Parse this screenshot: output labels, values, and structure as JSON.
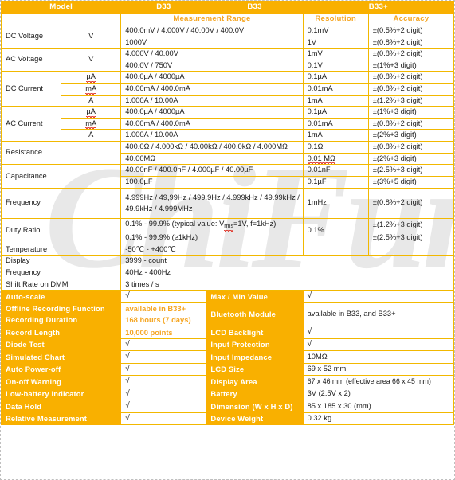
{
  "watermark": "ChiFun",
  "colors": {
    "accent": "#f9b000",
    "accent_text": "#f5a623",
    "border": "#f2b800"
  },
  "header": {
    "model": "Model",
    "d33": "D33",
    "b33": "B33",
    "b33plus": "B33+",
    "measurement_range": "Measurement Range",
    "resolution": "Resolution",
    "accuracy": "Accuracy"
  },
  "spec_rows": [
    {
      "name": "DC Voltage",
      "unit": "V",
      "range": "400.0mV / 4.000V / 40.00V / 400.0V",
      "resolution": "0.1mV",
      "accuracy": "±(0.5%+2 digit)"
    },
    {
      "name": "",
      "unit": "",
      "range": "1000V",
      "resolution": "1V",
      "accuracy": "±(0.8%+2 digit)"
    },
    {
      "name": "AC Voltage",
      "unit": "V",
      "range": "4.000V / 40.00V",
      "resolution": "1mV",
      "accuracy": "±(0.8%+2 digit)"
    },
    {
      "name": "",
      "unit": "",
      "range": "400.0V / 750V",
      "resolution": "0.1V",
      "accuracy": "±(1%+3 digit)"
    },
    {
      "name": "DC Current",
      "unit": "µA",
      "range": "400.0µA / 4000µA",
      "resolution": "0.1µA",
      "accuracy": "±(0.8%+2 digit)"
    },
    {
      "name": "",
      "unit": "mA",
      "range": "40.00mA / 400.0mA",
      "resolution": "0.01mA",
      "accuracy": "±(0.8%+2 digit)"
    },
    {
      "name": "",
      "unit": "A",
      "range": "1.000A / 10.00A",
      "resolution": "1mA",
      "accuracy": "±(1.2%+3 digit)"
    },
    {
      "name": "AC Current",
      "unit": "µA",
      "range": "400.0µA / 4000µA",
      "resolution": "0.1µA",
      "accuracy": "±(1%+3 digit)"
    },
    {
      "name": "",
      "unit": "mA",
      "range": "40.00mA / 400.0mA",
      "resolution": "0.01mA",
      "accuracy": "±(0.8%+2 digit)"
    },
    {
      "name": "",
      "unit": "A",
      "range": "1.000A / 10.00A",
      "resolution": "1mA",
      "accuracy": "±(2%+3 digit)"
    },
    {
      "name": "Resistance",
      "unit": "",
      "range": "400.0Ω / 4.000kΩ / 40.00kΩ / 400.0kΩ / 4.000MΩ",
      "resolution": "0.1Ω",
      "accuracy": "±(0.8%+2 digit)"
    },
    {
      "name": "",
      "unit": "",
      "range": "40.00MΩ",
      "resolution": "0.01 MΩ",
      "accuracy": "±(2%+3 digit)"
    },
    {
      "name": "Capacitance",
      "unit": "",
      "range": "40.00nF / 400.0nF / 4.000µF / 40.00µF",
      "resolution": "0.01nF",
      "accuracy": "±(2.5%+3 digit)"
    },
    {
      "name": "",
      "unit": "",
      "range": "100.0µF",
      "resolution": "0.1µF",
      "accuracy": "±(3%+5 digit)"
    }
  ],
  "frequency_row": {
    "name": "Frequency",
    "range_line1": "4.999Hz / 49,99Hz / 499.9Hz / 4.999kHz / 49.99kHz /",
    "range_line2": "49.9kHz / 4.999MHz",
    "resolution": "1mHz",
    "accuracy": "±(0.8%+2 digit)"
  },
  "duty_ratio": {
    "name": "Duty Ratio",
    "range1_pre": "0.1% - 99.9% (typical value: V",
    "range1_sub": "rms",
    "range1_post": "=1V, f=1kHz)",
    "range2": "0.1% - 99.9% (≥1kHz)",
    "resolution": "0.1%",
    "accuracy1": "±(1.2%+3 digit)",
    "accuracy2": "±(2.5%+3 digit)"
  },
  "simple_rows": [
    {
      "name": "Temperature",
      "value": "-50℃ - +400℃",
      "split": true
    },
    {
      "name": "Display",
      "value": "3999 - count",
      "split": false
    },
    {
      "name": "Frequency",
      "value": "40Hz - 400Hz",
      "split": false
    },
    {
      "name": "Shift Rate on DMM",
      "value": "3 times / s",
      "split": false
    }
  ],
  "features": {
    "auto_scale": {
      "label": "Auto-scale",
      "value": "√"
    },
    "max_min": {
      "label": "Max / Min Value",
      "value": "√"
    },
    "offline_recording": {
      "label": "Offline Recording Function",
      "value": "available in B33+"
    },
    "bluetooth": {
      "label": "Bluetooth Module",
      "value": "available in B33, and B33+"
    },
    "recording_duration": {
      "label": "Recording Duration",
      "value": "168 hours (7 days)"
    },
    "record_length": {
      "label": "Record Length",
      "value": "10,000 points"
    },
    "lcd_backlight": {
      "label": "LCD Backlight",
      "value": "√"
    },
    "diode_test": {
      "label": "Diode Test",
      "value": "√"
    },
    "input_protection": {
      "label": "Input Protection",
      "value": "√"
    },
    "simulated_chart": {
      "label": "Simulated Chart",
      "value": "√"
    },
    "input_impedance": {
      "label": "Input Impedance",
      "value": "10MΩ"
    },
    "auto_power_off": {
      "label": "Auto Power-off",
      "value": "√"
    },
    "lcd_size": {
      "label": "LCD Size",
      "value": "69 x 52 mm"
    },
    "on_off_warning": {
      "label": "On-off Warning",
      "value": "√"
    },
    "display_area": {
      "label": "Display Area",
      "value": "67 x 46 mm (effective area 66 x 45 mm)"
    },
    "low_battery": {
      "label": "Low-battery Indicator",
      "value": "√"
    },
    "battery": {
      "label": "Battery",
      "value": "3V (2.5V x 2)"
    },
    "data_hold": {
      "label": "Data Hold",
      "value": "√"
    },
    "dimension": {
      "label": "Dimension (W x H x D)",
      "value": "85 x 185 x 30 (mm)"
    },
    "relative_measurement": {
      "label": "Relative Measurement",
      "value": "√"
    },
    "device_weight": {
      "label": "Device Weight",
      "value": "0.32 kg"
    }
  }
}
